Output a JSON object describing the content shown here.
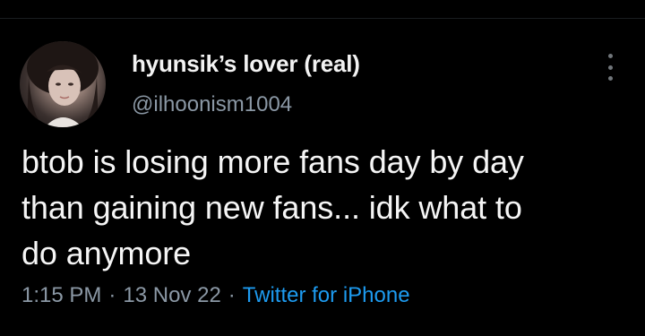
{
  "user": {
    "display_name": "hyunsik’s lover (real)",
    "handle": "@ilhoonism1004"
  },
  "tweet": {
    "text_lines": [
      "btob is losing more fans day by day",
      "than gaining new fans... idk what to",
      "do anymore"
    ],
    "time": "1:15 PM",
    "separator": "·",
    "date": "13 Nov 22",
    "source": "Twitter for iPhone"
  },
  "icons": {
    "more": "more-vertical-icon",
    "avatar": "profile-photo"
  },
  "colors": {
    "background": "#000000",
    "text": "#e7e9ea",
    "secondary": "#8b98a5",
    "link": "#1d9bf0"
  }
}
